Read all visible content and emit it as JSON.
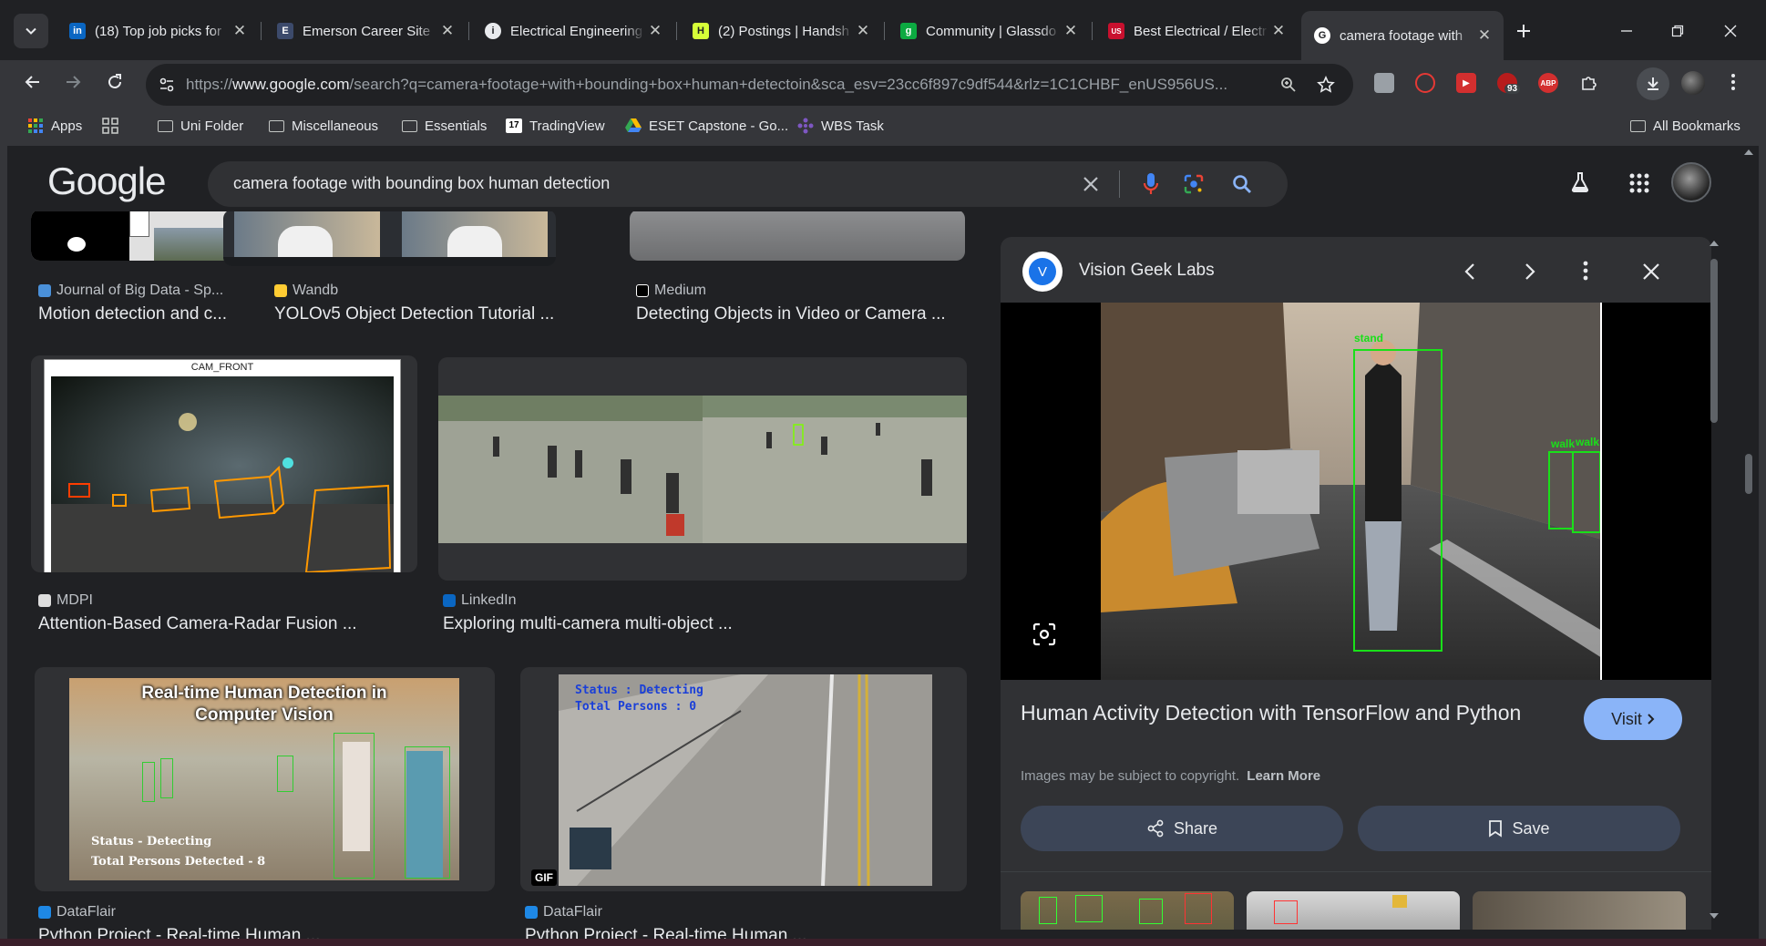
{
  "tabs": [
    {
      "title": "(18) Top job picks for",
      "favicon": "linkedin-icon",
      "color": "#0a66c2",
      "glyph": "in"
    },
    {
      "title": "Emerson Career Site",
      "favicon": "emerson-icon",
      "color": "#3c4a6b",
      "glyph": "E"
    },
    {
      "title": "Electrical Engineering",
      "favicon": "info-icon",
      "color": "#e8eaed",
      "glyph": "i"
    },
    {
      "title": "(2) Postings | Handsh",
      "favicon": "handshake-icon",
      "color": "#d6ff38",
      "glyph": "H"
    },
    {
      "title": "Community | Glassdo",
      "favicon": "glassdoor-icon",
      "color": "#0caa41",
      "glyph": "g"
    },
    {
      "title": "Best Electrical / Electr",
      "favicon": "usnews-icon",
      "color": "#c8102e",
      "glyph": "US"
    },
    {
      "title": "camera footage with",
      "favicon": "google-icon",
      "color": "#ffffff",
      "glyph": "G",
      "active": true
    }
  ],
  "toolbar": {
    "url_prefix": "https://",
    "url_host": "www.google.com",
    "url_rest": "/search?q=camera+footage+with+bounding+box+human+detectoin&sca_esv=23cc6f897c9df544&rlz=1C1CHBF_enUS956US...",
    "ext_badge": "93"
  },
  "bookmarks": [
    {
      "label": "Apps",
      "icon": "apps-grid-icon"
    },
    {
      "label": "",
      "icon": "tab-groups-icon"
    },
    {
      "label": "Uni Folder",
      "icon": "folder-icon"
    },
    {
      "label": "Miscellaneous",
      "icon": "folder-icon"
    },
    {
      "label": "Essentials",
      "icon": "folder-icon"
    },
    {
      "label": "TradingView",
      "icon": "tradingview-icon"
    },
    {
      "label": "ESET Capstone - Go...",
      "icon": "google-drive-icon"
    },
    {
      "label": "WBS Task",
      "icon": "wbs-icon"
    }
  ],
  "all_bookmarks": "All Bookmarks",
  "google": {
    "logo": "Google",
    "query": "camera footage with bounding box human detection"
  },
  "results": [
    {
      "source": "Journal of Big Data - Sp...",
      "caption": "Motion detection and c..."
    },
    {
      "source": "Wandb",
      "caption": "YOLOv5 Object Detection Tutorial ..."
    },
    {
      "source": "Medium",
      "caption": "Detecting Objects in Video or Camera ..."
    },
    {
      "source": "MDPI",
      "caption": "Attention-Based Camera-Radar Fusion ..."
    },
    {
      "source": "LinkedIn",
      "caption": "Exploring multi-camera multi-object ..."
    },
    {
      "source": "DataFlair",
      "caption": "Python Project - Real-time Human ..."
    },
    {
      "source": "DataFlair",
      "caption": "Python Project - Real-time Human ..."
    }
  ],
  "thumb_text": {
    "cam_front": "CAM_FRONT",
    "df_title_1": "Real-time Human Detection in",
    "df_title_2": "Computer Vision",
    "df_status": "Status - Detecting",
    "df_total": "Total Persons Detected - 8",
    "df2_status": "Status : Detecting",
    "df2_total": "Total Persons : 0",
    "gif": "GIF"
  },
  "panel": {
    "source_initial": "V",
    "source": "Vision Geek Labs",
    "label_stand": "stand",
    "label_walk1": "walk",
    "label_walk2": "walk",
    "title": "Human Activity Detection with TensorFlow and Python",
    "visit": "Visit",
    "copyright": "Images may be subject to copyright.",
    "learn_more": "Learn More",
    "share": "Share",
    "save": "Save"
  }
}
